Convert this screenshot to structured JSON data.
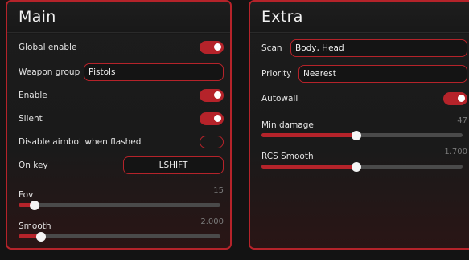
{
  "main": {
    "title": "Main",
    "global_enable": {
      "label": "Global enable",
      "on": true
    },
    "weapon_group": {
      "label": "Weapon group",
      "value": "Pistols"
    },
    "enable": {
      "label": "Enable",
      "on": true
    },
    "silent": {
      "label": "Silent",
      "on": true
    },
    "disable_flashed": {
      "label": "Disable aimbot when flashed",
      "on": false
    },
    "on_key": {
      "label": "On key",
      "value": "LSHIFT"
    },
    "fov": {
      "label": "Fov",
      "value_text": "15",
      "fraction": 0.08
    },
    "smooth": {
      "label": "Smooth",
      "value_text": "2.000",
      "fraction": 0.11
    }
  },
  "extra": {
    "title": "Extra",
    "scan": {
      "label": "Scan",
      "value": "Body, Head"
    },
    "priority": {
      "label": "Priority",
      "value": "Nearest"
    },
    "autowall": {
      "label": "Autowall",
      "on": true
    },
    "min_damage": {
      "label": "Min damage",
      "value_text": "47",
      "fraction": 0.47
    },
    "rcs_smooth": {
      "label": "RCS Smooth",
      "value_text": "1.700",
      "fraction": 0.47
    }
  },
  "colors": {
    "accent": "#b5232a",
    "background": "#131313",
    "panel": "#1c1c1c"
  }
}
